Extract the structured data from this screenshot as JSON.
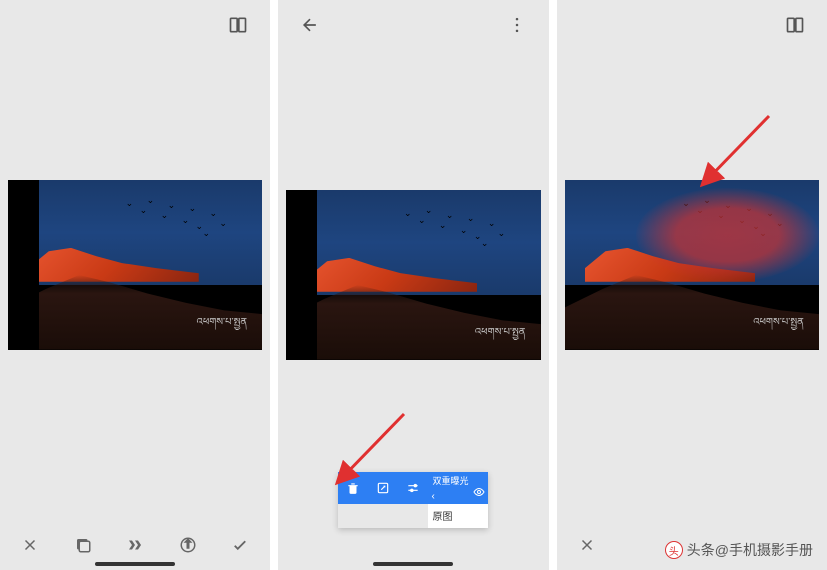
{
  "popup": {
    "effect_label": "双重曝光",
    "original_label": "原图"
  },
  "watermark": {
    "logo": "头",
    "text": "头条@手机摄影手册"
  },
  "photo_text": "འཕགས་པ་སྤྱན"
}
